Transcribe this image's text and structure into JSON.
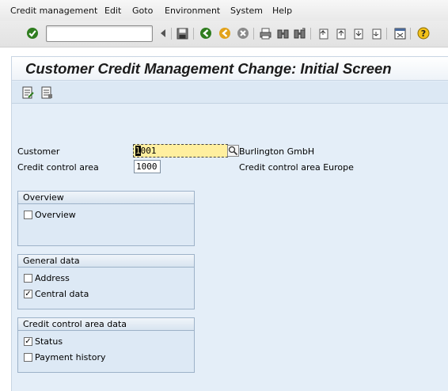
{
  "menu": [
    "Credit management",
    "Edit",
    "Goto",
    "Environment",
    "System",
    "Help"
  ],
  "command_field": {
    "value": ""
  },
  "title": "Customer Credit Management Change: Initial Screen",
  "form": {
    "customer_label": "Customer",
    "customer_value": "1001",
    "customer_value_first": "1",
    "customer_value_rest": "001",
    "customer_name": "Burlington GmbH",
    "cca_label": "Credit control area",
    "cca_value": "1000",
    "cca_name": "Credit control area Europe"
  },
  "groups": {
    "overview": {
      "title": "Overview",
      "items": [
        {
          "label": "Overview",
          "checked": false
        }
      ]
    },
    "general": {
      "title": "General data",
      "items": [
        {
          "label": "Address",
          "checked": false
        },
        {
          "label": "Central data",
          "checked": true
        }
      ]
    },
    "cca": {
      "title": "Credit control area data",
      "items": [
        {
          "label": "Status",
          "checked": true
        },
        {
          "label": "Payment history",
          "checked": false
        }
      ]
    }
  },
  "colors": {
    "accent_green": "#2f7d1f",
    "field_active": "#ffef9f",
    "panel": "#dde9f5"
  }
}
